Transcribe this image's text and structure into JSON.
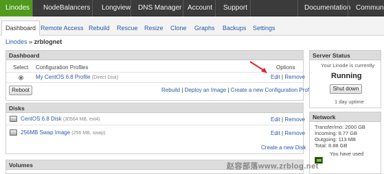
{
  "topnav": {
    "items": [
      {
        "label": "Linodes",
        "active": true
      },
      {
        "label": "NodeBalancers"
      },
      {
        "label": "Longview"
      },
      {
        "label": "DNS Manager"
      },
      {
        "label": "Account"
      },
      {
        "label": "Support"
      },
      {
        "label": "Documentation"
      },
      {
        "label": "Communi"
      }
    ]
  },
  "subnav": {
    "tabs": [
      "Dashboard",
      "Remote Access",
      "Rebuild",
      "Rescue",
      "Resize",
      "Clone",
      "Graphs",
      "Backups",
      "Settings"
    ]
  },
  "breadcrumb": {
    "root": "Linodes",
    "separator": "»",
    "current": "zrblognet"
  },
  "dashboard": {
    "title": "Dashboard",
    "col_select": "Select",
    "col_profiles": "Configuration Profiles",
    "col_options": "Options",
    "profile_name": "My CentOS 6.8 Profile",
    "profile_note": "(Direct Disk)",
    "edit": "Edit",
    "pipe": "|",
    "remove": "Remove",
    "reboot_label": "Reboot",
    "actions": {
      "rebuild": "Rebuild",
      "deploy": "Deploy an Image",
      "create": "Create a new Configuration Profile"
    }
  },
  "disks": {
    "title": "Disks",
    "items": [
      {
        "name": "CentOS 6.8 Disk",
        "meta": "(30564 MB, ext4)"
      },
      {
        "name": "256MB Swap Image",
        "meta": "(256 MB, swap)"
      }
    ],
    "edit": "Edit",
    "pipe": "|",
    "remove": "Remove",
    "create": "Create a new Disk"
  },
  "volumes": {
    "title": "Volumes"
  },
  "server_status": {
    "title": "Server Status",
    "line": "Your Linode is currently",
    "state": "Running",
    "button": "Shut down",
    "uptime": "1 day uptime"
  },
  "network": {
    "title": "Network",
    "lines": [
      "Transfer/mo: 2000 GB",
      "Incoming: 8.77 GB",
      "Outgoing: 113 MB",
      "Total: 8.88 GB"
    ],
    "used_label": "You have used"
  },
  "watermark": "赵容部落www.zrblog.net",
  "colors": {
    "accent_green": "#4f9a1d",
    "nav_dark": "#3b3b3b",
    "link_blue": "#2a5aa8",
    "arrow_red": "#e0202a"
  }
}
